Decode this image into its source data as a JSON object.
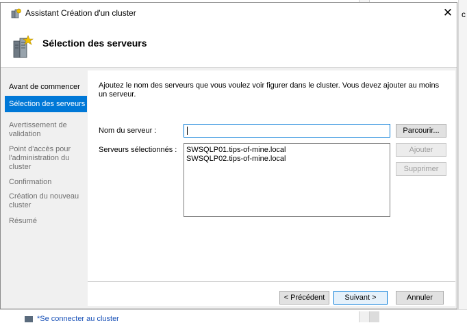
{
  "background": {
    "right_letter": "c",
    "bottom_link": "*Se connecter au cluster"
  },
  "window": {
    "title": "Assistant Création d'un cluster",
    "close_glyph": "✕"
  },
  "header": {
    "title": "Sélection des serveurs"
  },
  "nav": {
    "items": [
      {
        "label": "Avant de commencer"
      },
      {
        "label": "Sélection des serveurs"
      },
      {
        "label": "Avertissement de validation"
      },
      {
        "label": "Point d'accès pour l'administration du cluster"
      },
      {
        "label": "Confirmation"
      },
      {
        "label": "Création du nouveau cluster"
      },
      {
        "label": "Résumé"
      }
    ]
  },
  "content": {
    "description": "Ajoutez le nom des serveurs que vous voulez voir figurer dans le cluster. Vous devez ajouter au moins un serveur.",
    "server_name_label": "Nom du serveur :",
    "server_name_value": "",
    "selected_servers_label": "Serveurs sélectionnés :",
    "selected_servers": [
      "SWSQLP01.tips-of-mine.local",
      "SWSQLP02.tips-of-mine.local"
    ],
    "browse_button": "Parcourir...",
    "add_button": "Ajouter",
    "remove_button": "Supprimer"
  },
  "footer": {
    "previous_button": "< Précédent",
    "next_button": "Suivant >",
    "cancel_button": "Annuler"
  },
  "colors": {
    "accent": "#0078d7",
    "dialog_bg": "#f0f0f0"
  }
}
